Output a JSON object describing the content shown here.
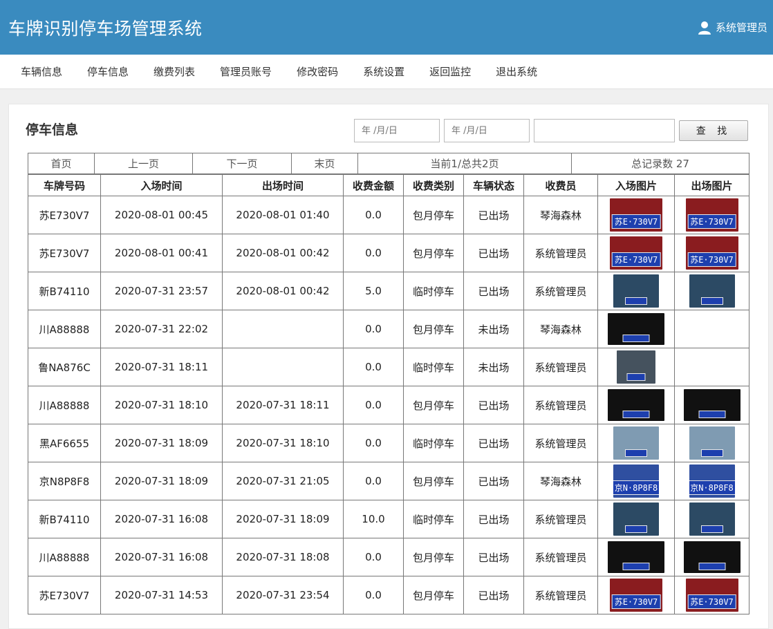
{
  "header": {
    "title": "车牌识别停车场管理系统",
    "user_name": "系统管理员",
    "user_icon": "user-icon"
  },
  "nav": [
    {
      "label": "车辆信息",
      "key": "vehicle"
    },
    {
      "label": "停车信息",
      "key": "parking"
    },
    {
      "label": "缴费列表",
      "key": "payment"
    },
    {
      "label": "管理员账号",
      "key": "admin"
    },
    {
      "label": "修改密码",
      "key": "password"
    },
    {
      "label": "系统设置",
      "key": "settings"
    },
    {
      "label": "返回监控",
      "key": "monitor"
    },
    {
      "label": "退出系统",
      "key": "logout"
    }
  ],
  "page": {
    "title": "停车信息"
  },
  "search": {
    "start_date_placeholder": "年 /月/日",
    "end_date_placeholder": "年 /月/日",
    "keyword_value": "",
    "search_label": "查 找"
  },
  "pager": {
    "first": "首页",
    "prev": "上一页",
    "next": "下一页",
    "last": "末页",
    "page_info": "当前1/总共2页",
    "total": "总记录数 27"
  },
  "table": {
    "headers": [
      "车牌号码",
      "入场时间",
      "出场时间",
      "收费金额",
      "收费类别",
      "车辆状态",
      "收费员",
      "入场图片",
      "出场图片"
    ],
    "rows": [
      {
        "plate": "苏E730V7",
        "in": "2020-08-01 00:45",
        "out": "2020-08-01 01:40",
        "fee": "0.0",
        "type": "包月停车",
        "status": "已出场",
        "operator": "琴海森林",
        "in_img": "red-sedan",
        "out_img": "red-sedan"
      },
      {
        "plate": "苏E730V7",
        "in": "2020-08-01 00:41",
        "out": "2020-08-01 00:42",
        "fee": "0.0",
        "type": "包月停车",
        "status": "已出场",
        "operator": "系统管理员",
        "in_img": "red-sedan",
        "out_img": "red-sedan"
      },
      {
        "plate": "新B74110",
        "in": "2020-07-31 23:57",
        "out": "2020-08-01 00:42",
        "fee": "5.0",
        "type": "临时停车",
        "status": "已出场",
        "operator": "系统管理员",
        "in_img": "blue-sedan",
        "out_img": "blue-sedan"
      },
      {
        "plate": "川A88888",
        "in": "2020-07-31 22:02",
        "out": "",
        "fee": "0.0",
        "type": "包月停车",
        "status": "未出场",
        "operator": "琴海森林",
        "in_img": "black-car",
        "out_img": ""
      },
      {
        "plate": "鲁NA876C",
        "in": "2020-07-31 18:11",
        "out": "",
        "fee": "0.0",
        "type": "临时停车",
        "status": "未出场",
        "operator": "系统管理员",
        "in_img": "street-car",
        "out_img": ""
      },
      {
        "plate": "川A88888",
        "in": "2020-07-31 18:10",
        "out": "2020-07-31 18:11",
        "fee": "0.0",
        "type": "包月停车",
        "status": "已出场",
        "operator": "系统管理员",
        "in_img": "black-car",
        "out_img": "black-car"
      },
      {
        "plate": "黑AF6655",
        "in": "2020-07-31 18:09",
        "out": "2020-07-31 18:10",
        "fee": "0.0",
        "type": "临时停车",
        "status": "已出场",
        "operator": "系统管理员",
        "in_img": "silver-car",
        "out_img": "silver-car"
      },
      {
        "plate": "京N8P8F8",
        "in": "2020-07-31 18:09",
        "out": "2020-07-31 21:05",
        "fee": "0.0",
        "type": "包月停车",
        "status": "已出场",
        "operator": "琴海森林",
        "in_img": "blue-plate",
        "out_img": "blue-plate"
      },
      {
        "plate": "新B74110",
        "in": "2020-07-31 16:08",
        "out": "2020-07-31 18:09",
        "fee": "10.0",
        "type": "临时停车",
        "status": "已出场",
        "operator": "系统管理员",
        "in_img": "blue-sedan",
        "out_img": "blue-sedan"
      },
      {
        "plate": "川A88888",
        "in": "2020-07-31 16:08",
        "out": "2020-07-31 18:08",
        "fee": "0.0",
        "type": "包月停车",
        "status": "已出场",
        "operator": "系统管理员",
        "in_img": "black-car",
        "out_img": "black-car"
      },
      {
        "plate": "苏E730V7",
        "in": "2020-07-31 14:53",
        "out": "2020-07-31 23:54",
        "fee": "0.0",
        "type": "包月停车",
        "status": "已出场",
        "operator": "系统管理员",
        "in_img": "red-sedan",
        "out_img": "red-sedan"
      }
    ]
  },
  "images": {
    "red-sedan": {
      "plate_text": "苏E·730V7",
      "bg": "#8a1c1f",
      "w": 76,
      "h": 48
    },
    "blue-sedan": {
      "plate_text": "",
      "bg": "#2c4a64",
      "w": 66,
      "h": 48
    },
    "black-car": {
      "plate_text": "",
      "bg": "#111111",
      "w": 82,
      "h": 46
    },
    "street-car": {
      "plate_text": "",
      "bg": "#45525e",
      "w": 56,
      "h": 48
    },
    "silver-car": {
      "plate_text": "",
      "bg": "#7f9bb2",
      "w": 66,
      "h": 48
    },
    "blue-plate": {
      "plate_text": "京N·8P8F8",
      "bg": "#2f4fa0",
      "w": 66,
      "h": 48
    }
  }
}
